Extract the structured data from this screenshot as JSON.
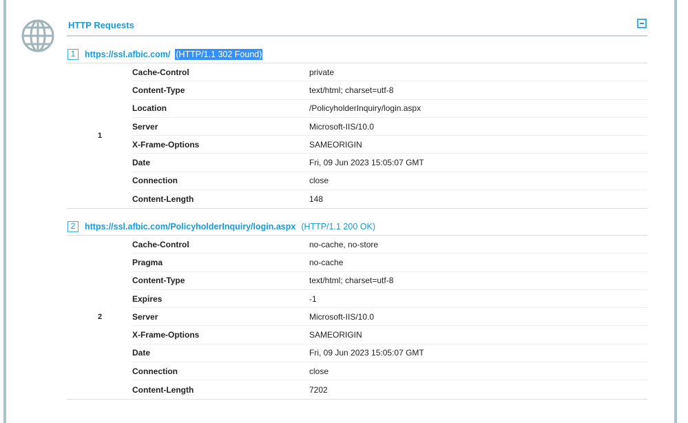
{
  "section": {
    "title": "HTTP Requests"
  },
  "requests": [
    {
      "number": "1",
      "url": "https://ssl.afbic.com/",
      "status": "(HTTP/1.1 302 Found)",
      "headers": [
        [
          "Cache-Control",
          "private"
        ],
        [
          "Content-Type",
          "text/html; charset=utf-8"
        ],
        [
          "Location",
          "/PolicyholderInquiry/login.aspx"
        ],
        [
          "Server",
          "Microsoft-IIS/10.0"
        ],
        [
          "X-Frame-Options",
          "SAMEORIGIN"
        ],
        [
          "Date",
          "Fri, 09 Jun 2023 15:05:07 GMT"
        ],
        [
          "Connection",
          "close"
        ],
        [
          "Content-Length",
          "148"
        ]
      ]
    },
    {
      "number": "2",
      "url": "https://ssl.afbic.com/PolicyholderInquiry/login.aspx",
      "status": "(HTTP/1.1 200 OK)",
      "headers": [
        [
          "Cache-Control",
          "no-cache, no-store"
        ],
        [
          "Pragma",
          "no-cache"
        ],
        [
          "Content-Type",
          "text/html; charset=utf-8"
        ],
        [
          "Expires",
          "-1"
        ],
        [
          "Server",
          "Microsoft-IIS/10.0"
        ],
        [
          "X-Frame-Options",
          "SAMEORIGIN"
        ],
        [
          "Date",
          "Fri, 09 Jun 2023 15:05:07 GMT"
        ],
        [
          "Connection",
          "close"
        ],
        [
          "Content-Length",
          "7202"
        ]
      ]
    }
  ]
}
